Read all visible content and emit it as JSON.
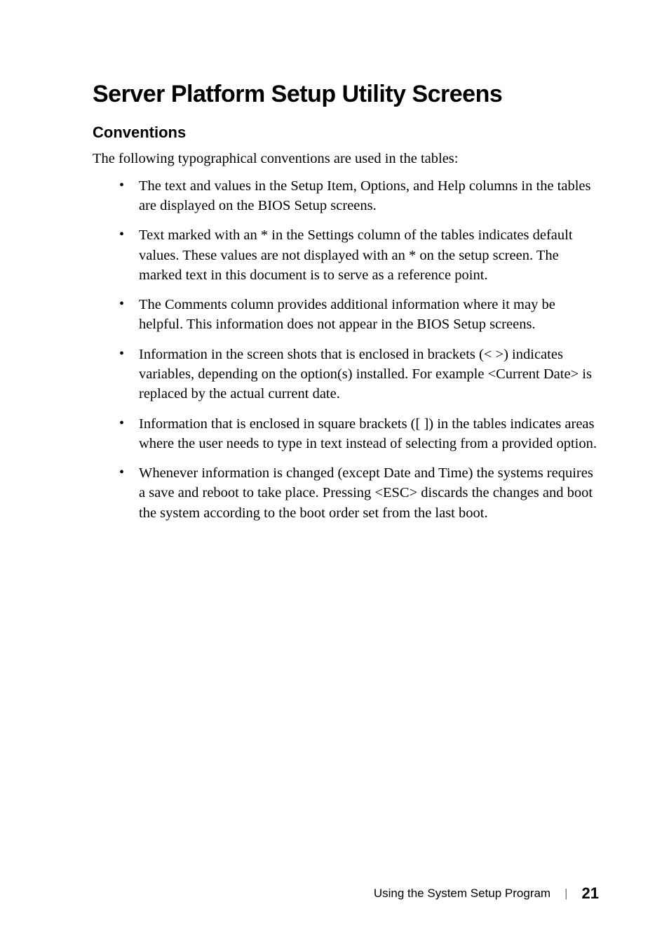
{
  "heading1": "Server Platform Setup Utility Screens",
  "heading2": "Conventions",
  "intro": "The following typographical conventions are used in the tables:",
  "bullets": [
    "The text and values in the Setup Item, Options, and Help columns in the tables are displayed on the BIOS Setup screens.",
    "Text marked with an * in the Settings column of the tables indicates default values. These values are not displayed with an * on the setup screen. The marked text in this document is to serve as a reference point.",
    "The Comments column provides additional information where it may be helpful. This information does not appear in the BIOS Setup screens.",
    "Information in the screen shots that is enclosed in brackets (< >) indicates variables, depending on the option(s) installed. For example <Current Date> is replaced by the actual current date.",
    "Information that is enclosed in square brackets ([ ]) in the tables indicates areas where the user needs to type in text instead of selecting from a provided option.",
    "Whenever information is changed (except Date and Time) the systems requires a save and reboot to take place. Pressing <ESC> discards the changes and boot the system according to the boot order set from the last boot."
  ],
  "footer": {
    "label": "Using the System Setup Program",
    "separator": "|",
    "page": "21"
  }
}
